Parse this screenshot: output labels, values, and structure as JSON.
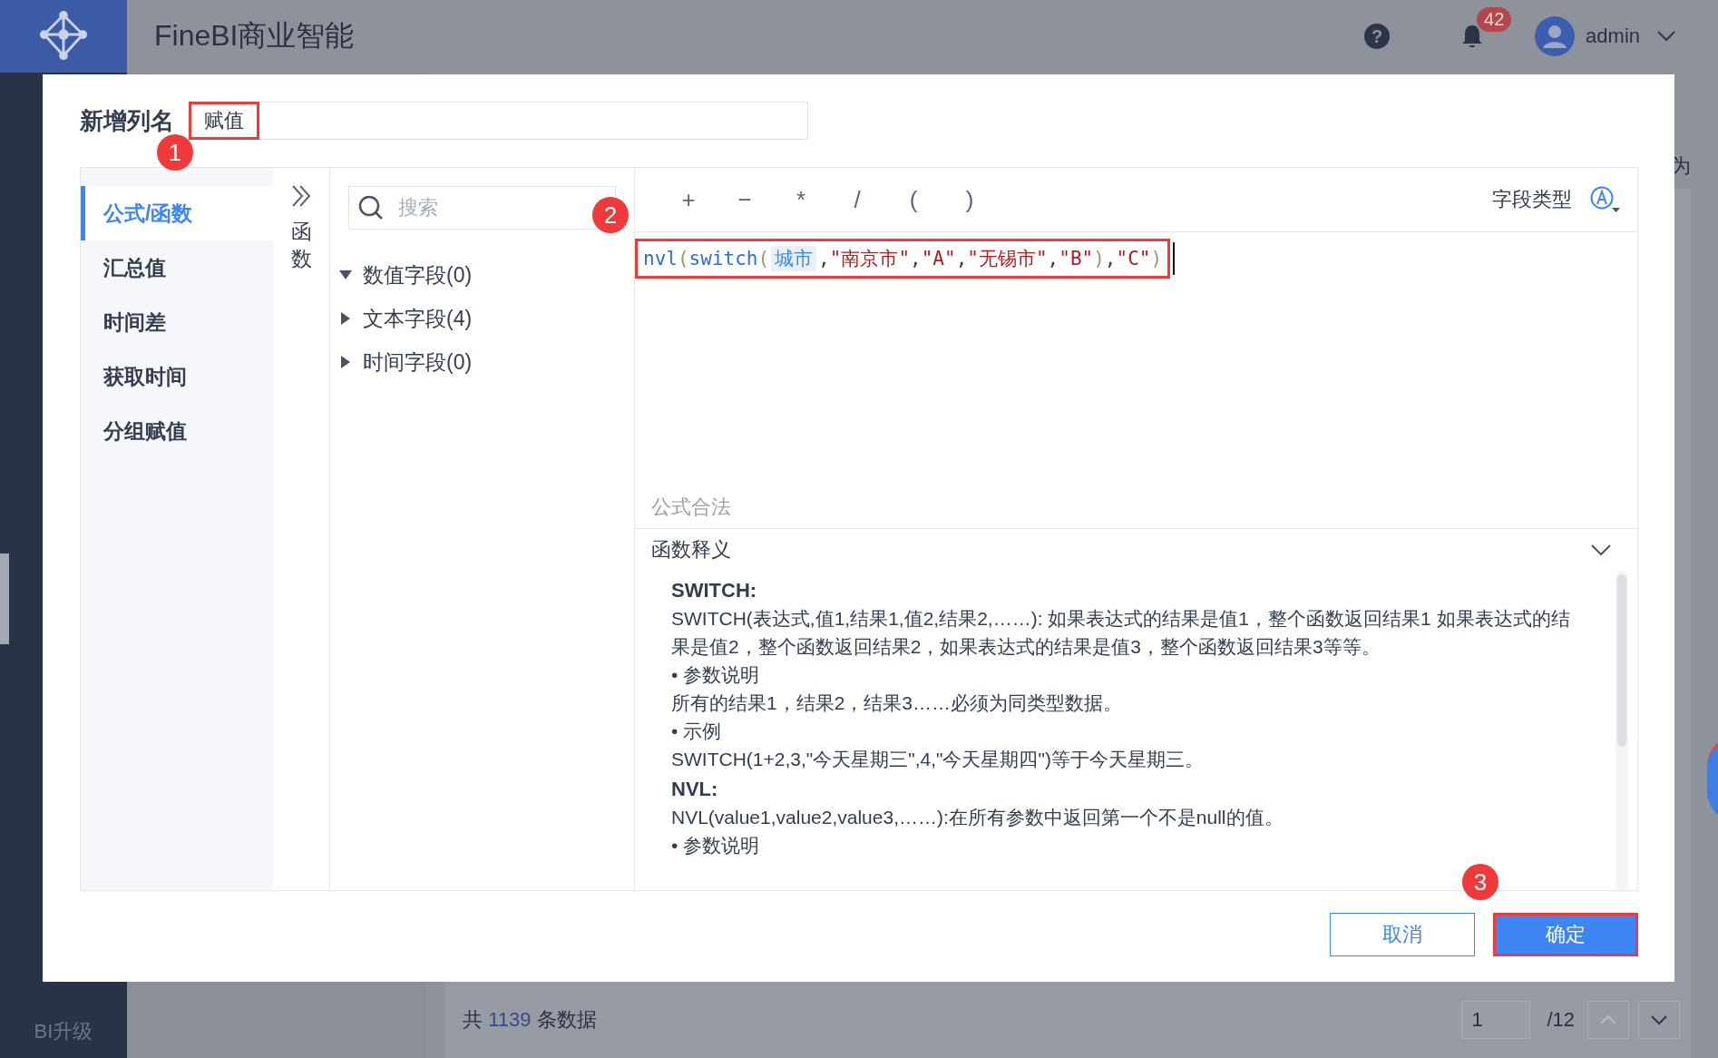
{
  "app_bar": {
    "title": "FineBI商业智能",
    "help": "?",
    "notification_count": "42",
    "user": "admin"
  },
  "sidebar": {
    "upgrade": "BI升级"
  },
  "content": {
    "side_text": "为",
    "footer": {
      "prefix": "共",
      "count": "1139",
      "suffix": "条数据"
    },
    "pagination": {
      "page": "1",
      "total": "/12"
    }
  },
  "dialog": {
    "name_label": "新增列名",
    "name_value": "赋值",
    "name_highlighted": true,
    "name_annotation": "1",
    "nav": [
      {
        "label": "公式/函数",
        "selected": true
      },
      {
        "label": "汇总值",
        "selected": false
      },
      {
        "label": "时间差",
        "selected": false
      },
      {
        "label": "获取时间",
        "selected": false
      },
      {
        "label": "分组赋值",
        "selected": false
      }
    ],
    "collapse_label": "函数",
    "search_placeholder": "搜索",
    "field_groups": [
      {
        "label": "数值字段(0)",
        "expanded": true
      },
      {
        "label": "文本字段(4)",
        "expanded": false
      },
      {
        "label": "时间字段(0)",
        "expanded": false
      }
    ],
    "operators": [
      "+",
      "−",
      "*",
      "/",
      "(",
      ")"
    ],
    "field_type_label": "字段类型",
    "formula": {
      "highlighted": true,
      "annotation": "2",
      "tokens": [
        {
          "text": "nvl",
          "kind": "function"
        },
        {
          "text": "(",
          "kind": "paren"
        },
        {
          "text": "switch",
          "kind": "function"
        },
        {
          "text": "(",
          "kind": "paren"
        },
        {
          "text": "城市",
          "kind": "field"
        },
        {
          "text": ",",
          "kind": "comma"
        },
        {
          "text": "\"南京市\"",
          "kind": "string"
        },
        {
          "text": ",",
          "kind": "comma"
        },
        {
          "text": "\"A\"",
          "kind": "string"
        },
        {
          "text": ",",
          "kind": "comma"
        },
        {
          "text": "\"无锡市\"",
          "kind": "string"
        },
        {
          "text": ",",
          "kind": "comma"
        },
        {
          "text": "\"B\"",
          "kind": "string"
        },
        {
          "text": ")",
          "kind": "paren"
        },
        {
          "text": ",",
          "kind": "comma"
        },
        {
          "text": "\"C\"",
          "kind": "string"
        },
        {
          "text": ")",
          "kind": "paren"
        }
      ]
    },
    "status": "公式合法",
    "help": {
      "title": "函数释义",
      "lines": [
        {
          "kind": "heading",
          "text": "SWITCH:"
        },
        {
          "kind": "text",
          "text": "SWITCH(表达式,值1,结果1,值2,结果2,……): 如果表达式的结果是值1，整个函数返回结果1 如果表达式的结果是值2，整个函数返回结果2，如果表达式的结果是值3，整个函数返回结果3等等。"
        },
        {
          "kind": "text",
          "text": "•  参数说明"
        },
        {
          "kind": "text",
          "text": "所有的结果1，结果2，结果3……必须为同类型数据。"
        },
        {
          "kind": "text",
          "text": "•  示例"
        },
        {
          "kind": "text",
          "text": "SWITCH(1+2,3,\"今天星期三\",4,\"今天星期四\")等于今天星期三。"
        },
        {
          "kind": "heading",
          "text": "NVL:"
        },
        {
          "kind": "text",
          "text": "NVL(value1,value2,value3,……):在所有参数中返回第一个不是null的值。"
        },
        {
          "kind": "text",
          "text": "• 参数说明"
        }
      ]
    },
    "buttons": {
      "cancel": "取消",
      "ok": "确定",
      "ok_highlighted": true,
      "ok_annotation": "3"
    }
  }
}
